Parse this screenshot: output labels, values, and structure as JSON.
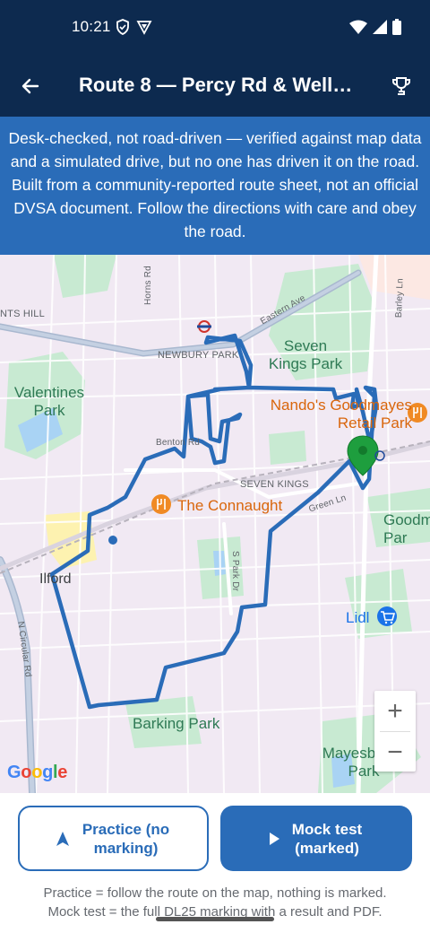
{
  "status_bar": {
    "time": "10:21",
    "icons_left": [
      "shield-icon",
      "vpn-icon"
    ],
    "icons_right": [
      "wifi-icon",
      "signal-icon",
      "battery-icon"
    ]
  },
  "app_bar": {
    "title": "Route 8 — Percy Rd & Well…",
    "back_icon": "arrow-left-icon",
    "trophy_icon": "trophy-icon"
  },
  "banner": {
    "text": "Desk-checked, not road-driven — verified against map data and a simulated drive, but no one has driven it on the road. Built from a community-reported route sheet, not an official DVSA document. Follow the directions with care and obey the road."
  },
  "map": {
    "labels": {
      "nts_hill": "NTS HILL",
      "horns_rd": "Horns Rd",
      "eastern_ave": "Eastern Ave",
      "barley_ln": "Barley Ln",
      "newbury_park": "NEWBURY PARK",
      "seven_kings_park": "Seven Kings Park",
      "valentines_park": "Valentines Park",
      "nandos": "Nando's Goodmayes Retail Park",
      "benton_rd": "Benton Rd",
      "seven_kings": "SEVEN KINGS",
      "the_connaught": "The Connaught",
      "green_ln": "Green Ln",
      "goodmayes_park": "Goodm Par",
      "ilford": "Ilford",
      "s_park_dr": "S Park Dr",
      "lidl": "Lidl",
      "n_circular_rd": "N Circular Rd",
      "barking_park": "Barking Park",
      "mayesbrook_park": "Mayesbrook Park",
      "google": "Google"
    },
    "route_color": "#2a6cb8",
    "start_pin_color": "#1e9e3e",
    "zoom_in": "+",
    "zoom_out": "−"
  },
  "actions": {
    "practice_label": "Practice (no marking)",
    "practice_icon": "navigation-arrow-icon",
    "mock_label": "Mock test (marked)",
    "mock_icon": "play-icon"
  },
  "footnote": {
    "line1": "Practice = follow the route on the map, nothing is marked.",
    "line2": "Mock test = the full DL25 marking with a result and PDF."
  }
}
